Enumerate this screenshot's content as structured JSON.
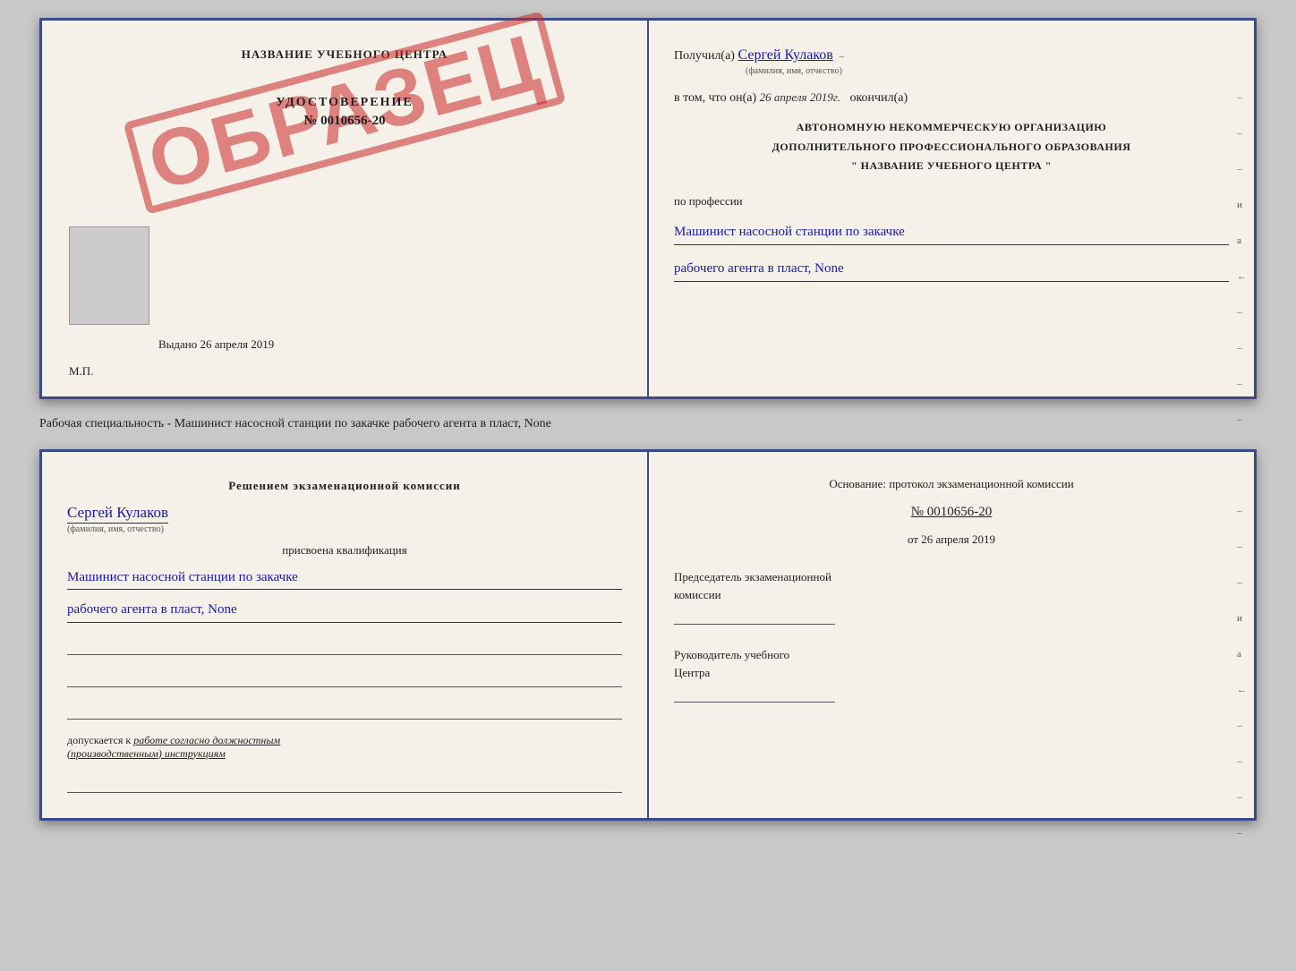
{
  "topDoc": {
    "left": {
      "schoolName": "НАЗВАНИЕ УЧЕБНОГО ЦЕНТРА",
      "stampText": "ОБРАЗЕЦ",
      "udostTitle": "УДОСТОВЕРЕНИЕ",
      "udostNumber": "№ 0010656-20",
      "issuedLabel": "Выдано",
      "issuedDate": "26 апреля 2019",
      "mpLabel": "М.П."
    },
    "right": {
      "receivedLabel": "Получил(а)",
      "receivedName": "Сергей Кулаков",
      "receivedHint": "(фамилия, имя, отчество)",
      "datePrefixLabel": "в том, что он(а)",
      "dateValue": "26 апреля 2019г.",
      "datePostfix": "окончил(а)",
      "orgLine1": "АВТОНОМНУЮ НЕКОММЕРЧЕСКУЮ ОРГАНИЗАЦИЮ",
      "orgLine2": "ДОПОЛНИТЕЛЬНОГО ПРОФЕССИОНАЛЬНОГО ОБРАЗОВАНИЯ",
      "orgLine3": "\" НАЗВАНИЕ УЧЕБНОГО ЦЕНТРА \"",
      "profLabel": "по профессии",
      "profValue1": "Машинист насосной станции по закачке",
      "profValue2": "рабочего агента в пласт, None",
      "sideMarks": [
        "-",
        "-",
        "-",
        "и",
        "а",
        "←",
        "-",
        "-",
        "-",
        "-"
      ]
    }
  },
  "middleText": "Рабочая специальность - Машинист насосной станции по закачке рабочего агента в пласт, None",
  "bottomDoc": {
    "left": {
      "commissionTitle": "Решением экзаменационной комиссии",
      "personName": "Сергей Кулаков",
      "personHint": "(фамилия, имя, отчество)",
      "assignedLabel": "присвоена квалификация",
      "qualValue1": "Машинист насосной станции по закачке",
      "qualValue2": "рабочего агента в пласт, None",
      "допускается1": "допускается к",
      "допускается2": "работе согласно должностным",
      "допускается3": "(производственным) инструкциям"
    },
    "right": {
      "osnovLabel": "Основание: протокол экзаменационной комиссии",
      "protocolNumber": "№ 0010656-20",
      "protocolDatePrefix": "от",
      "protocolDate": "26 апреля 2019",
      "chairLabel1": "Председатель экзаменационной",
      "chairLabel2": "комиссии",
      "headLabel1": "Руководитель учебного",
      "headLabel2": "Центра",
      "sideMarks": [
        "-",
        "-",
        "-",
        "и",
        "а",
        "←",
        "-",
        "-",
        "-",
        "-"
      ]
    }
  }
}
